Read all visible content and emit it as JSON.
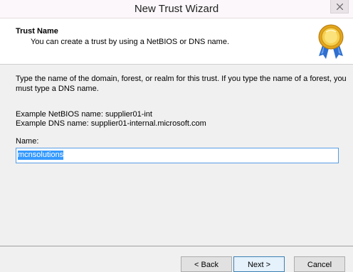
{
  "window": {
    "title": "New Trust Wizard"
  },
  "header": {
    "title": "Trust Name",
    "subtitle": "You can create a trust by using a NetBIOS or DNS name.",
    "icon": "award-ribbon-icon"
  },
  "body": {
    "instruction_line1": "Type the name of the domain, forest, or realm for this trust. If you type the name of a forest, you",
    "instruction_line2": "must type a DNS name.",
    "example_netbios": "Example NetBIOS name: supplier01-int",
    "example_dns": "Example DNS name: supplier01-internal.microsoft.com",
    "name_label": "Name:",
    "name_value": "mcnsolutions"
  },
  "buttons": {
    "back": "< Back",
    "next": "Next >",
    "cancel": "Cancel"
  },
  "colors": {
    "selection": "#3399ff",
    "input_focus_border": "#569de5",
    "default_button_border": "#3c7fb1"
  }
}
